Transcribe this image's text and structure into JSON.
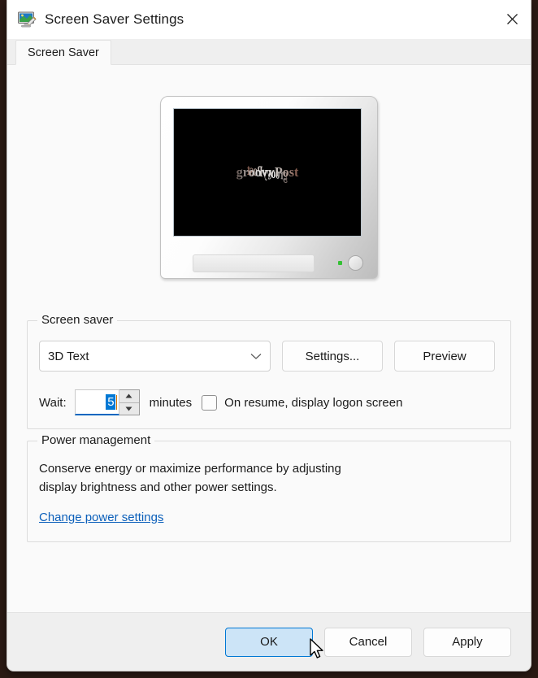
{
  "window": {
    "title": "Screen Saver Settings",
    "icon": "display-settings-icon",
    "close_label": "✕"
  },
  "tabs": [
    {
      "label": "Screen Saver",
      "active": true
    }
  ],
  "preview": {
    "monitor_icon": "crt-monitor-preview",
    "screen_background": "#000000",
    "saver_text": "groovyPost",
    "led_color": "#35c135"
  },
  "screen_saver_group": {
    "title": "Screen saver",
    "dropdown": {
      "value": "3D Text",
      "placeholder": "3D Text",
      "chevron": "chevron-down-icon"
    },
    "settings_button": "Settings...",
    "preview_button": "Preview",
    "wait_label": "Wait:",
    "wait_value": "5",
    "minutes_label": "minutes",
    "logon_checkbox_label": "On resume, display logon screen",
    "logon_checkbox_checked": false,
    "accent_color": "#0078d4"
  },
  "power_group": {
    "title": "Power management",
    "description_line1": "Conserve energy or maximize performance by adjusting",
    "description_line2": "display brightness and other power settings.",
    "link": "Change power settings",
    "link_color": "#0b5fba"
  },
  "footer": {
    "ok": "OK",
    "cancel": "Cancel",
    "apply": "Apply"
  }
}
